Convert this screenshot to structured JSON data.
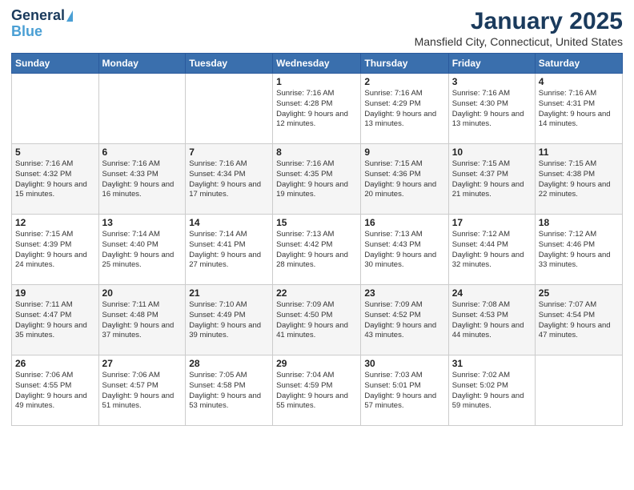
{
  "header": {
    "logo_line1": "General",
    "logo_line2": "Blue",
    "month": "January 2025",
    "location": "Mansfield City, Connecticut, United States"
  },
  "weekdays": [
    "Sunday",
    "Monday",
    "Tuesday",
    "Wednesday",
    "Thursday",
    "Friday",
    "Saturday"
  ],
  "weeks": [
    [
      {
        "day": "",
        "info": ""
      },
      {
        "day": "",
        "info": ""
      },
      {
        "day": "",
        "info": ""
      },
      {
        "day": "1",
        "info": "Sunrise: 7:16 AM\nSunset: 4:28 PM\nDaylight: 9 hours\nand 12 minutes."
      },
      {
        "day": "2",
        "info": "Sunrise: 7:16 AM\nSunset: 4:29 PM\nDaylight: 9 hours\nand 13 minutes."
      },
      {
        "day": "3",
        "info": "Sunrise: 7:16 AM\nSunset: 4:30 PM\nDaylight: 9 hours\nand 13 minutes."
      },
      {
        "day": "4",
        "info": "Sunrise: 7:16 AM\nSunset: 4:31 PM\nDaylight: 9 hours\nand 14 minutes."
      }
    ],
    [
      {
        "day": "5",
        "info": "Sunrise: 7:16 AM\nSunset: 4:32 PM\nDaylight: 9 hours\nand 15 minutes."
      },
      {
        "day": "6",
        "info": "Sunrise: 7:16 AM\nSunset: 4:33 PM\nDaylight: 9 hours\nand 16 minutes."
      },
      {
        "day": "7",
        "info": "Sunrise: 7:16 AM\nSunset: 4:34 PM\nDaylight: 9 hours\nand 17 minutes."
      },
      {
        "day": "8",
        "info": "Sunrise: 7:16 AM\nSunset: 4:35 PM\nDaylight: 9 hours\nand 19 minutes."
      },
      {
        "day": "9",
        "info": "Sunrise: 7:15 AM\nSunset: 4:36 PM\nDaylight: 9 hours\nand 20 minutes."
      },
      {
        "day": "10",
        "info": "Sunrise: 7:15 AM\nSunset: 4:37 PM\nDaylight: 9 hours\nand 21 minutes."
      },
      {
        "day": "11",
        "info": "Sunrise: 7:15 AM\nSunset: 4:38 PM\nDaylight: 9 hours\nand 22 minutes."
      }
    ],
    [
      {
        "day": "12",
        "info": "Sunrise: 7:15 AM\nSunset: 4:39 PM\nDaylight: 9 hours\nand 24 minutes."
      },
      {
        "day": "13",
        "info": "Sunrise: 7:14 AM\nSunset: 4:40 PM\nDaylight: 9 hours\nand 25 minutes."
      },
      {
        "day": "14",
        "info": "Sunrise: 7:14 AM\nSunset: 4:41 PM\nDaylight: 9 hours\nand 27 minutes."
      },
      {
        "day": "15",
        "info": "Sunrise: 7:13 AM\nSunset: 4:42 PM\nDaylight: 9 hours\nand 28 minutes."
      },
      {
        "day": "16",
        "info": "Sunrise: 7:13 AM\nSunset: 4:43 PM\nDaylight: 9 hours\nand 30 minutes."
      },
      {
        "day": "17",
        "info": "Sunrise: 7:12 AM\nSunset: 4:44 PM\nDaylight: 9 hours\nand 32 minutes."
      },
      {
        "day": "18",
        "info": "Sunrise: 7:12 AM\nSunset: 4:46 PM\nDaylight: 9 hours\nand 33 minutes."
      }
    ],
    [
      {
        "day": "19",
        "info": "Sunrise: 7:11 AM\nSunset: 4:47 PM\nDaylight: 9 hours\nand 35 minutes."
      },
      {
        "day": "20",
        "info": "Sunrise: 7:11 AM\nSunset: 4:48 PM\nDaylight: 9 hours\nand 37 minutes."
      },
      {
        "day": "21",
        "info": "Sunrise: 7:10 AM\nSunset: 4:49 PM\nDaylight: 9 hours\nand 39 minutes."
      },
      {
        "day": "22",
        "info": "Sunrise: 7:09 AM\nSunset: 4:50 PM\nDaylight: 9 hours\nand 41 minutes."
      },
      {
        "day": "23",
        "info": "Sunrise: 7:09 AM\nSunset: 4:52 PM\nDaylight: 9 hours\nand 43 minutes."
      },
      {
        "day": "24",
        "info": "Sunrise: 7:08 AM\nSunset: 4:53 PM\nDaylight: 9 hours\nand 44 minutes."
      },
      {
        "day": "25",
        "info": "Sunrise: 7:07 AM\nSunset: 4:54 PM\nDaylight: 9 hours\nand 47 minutes."
      }
    ],
    [
      {
        "day": "26",
        "info": "Sunrise: 7:06 AM\nSunset: 4:55 PM\nDaylight: 9 hours\nand 49 minutes."
      },
      {
        "day": "27",
        "info": "Sunrise: 7:06 AM\nSunset: 4:57 PM\nDaylight: 9 hours\nand 51 minutes."
      },
      {
        "day": "28",
        "info": "Sunrise: 7:05 AM\nSunset: 4:58 PM\nDaylight: 9 hours\nand 53 minutes."
      },
      {
        "day": "29",
        "info": "Sunrise: 7:04 AM\nSunset: 4:59 PM\nDaylight: 9 hours\nand 55 minutes."
      },
      {
        "day": "30",
        "info": "Sunrise: 7:03 AM\nSunset: 5:01 PM\nDaylight: 9 hours\nand 57 minutes."
      },
      {
        "day": "31",
        "info": "Sunrise: 7:02 AM\nSunset: 5:02 PM\nDaylight: 9 hours\nand 59 minutes."
      },
      {
        "day": "",
        "info": ""
      }
    ]
  ]
}
